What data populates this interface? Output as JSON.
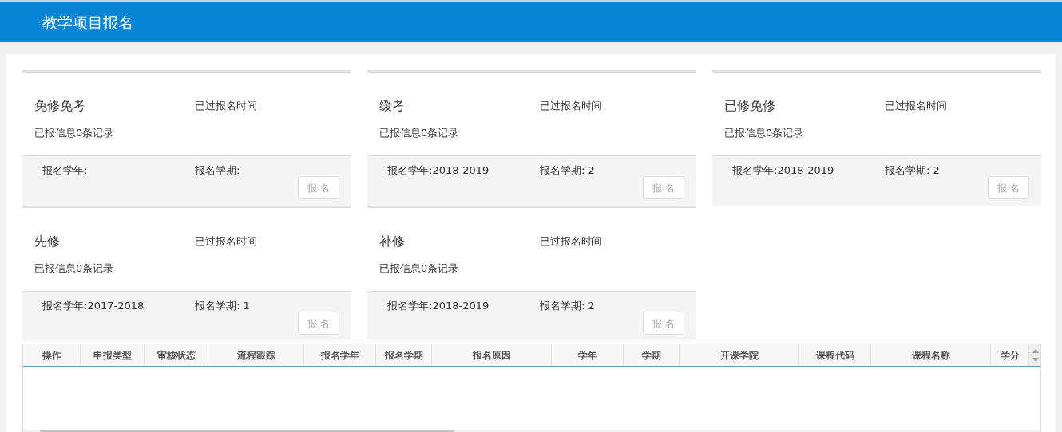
{
  "header": {
    "title": "教学项目报名"
  },
  "cards": [
    {
      "title": "免修免考",
      "status": "已过报名时间",
      "records": "已报信息0条记录",
      "year": "报名学年:",
      "term": "报名学期:",
      "button": {
        "label": "报 名",
        "disabled": true
      }
    },
    {
      "title": "缓考",
      "status": "已过报名时间",
      "records": "已报信息0条记录",
      "year": "报名学年:2018-2019",
      "term": "报名学期: 2",
      "button": {
        "label": "报 名",
        "disabled": true
      }
    },
    {
      "title": "已修免修",
      "status": "已过报名时间",
      "records": "已报信息0条记录",
      "year": "报名学年:2018-2019",
      "term": "报名学期: 2",
      "button": {
        "label": "报 名",
        "disabled": true
      }
    },
    {
      "title": "先修",
      "status": "已过报名时间",
      "records": "已报信息0条记录",
      "year": "报名学年:2017-2018",
      "term": "报名学期: 1",
      "button": {
        "label": "报 名",
        "disabled": true
      }
    },
    {
      "title": "补修",
      "status": "已过报名时间",
      "records": "已报信息0条记录",
      "year": "报名学年:2018-2019",
      "term": "报名学期: 2",
      "button": {
        "label": "报 名",
        "disabled": true
      }
    }
  ],
  "table": {
    "columns": [
      "操作",
      "申报类型",
      "审核状态",
      "流程跟踪",
      "报名学年",
      "报名学期",
      "报名原因",
      "学年",
      "学期",
      "开课学院",
      "课程代码",
      "课程名称",
      "学分"
    ]
  }
}
